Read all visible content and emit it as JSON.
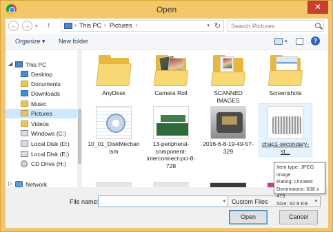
{
  "window": {
    "title": "Open",
    "close_glyph": "✕"
  },
  "address_bar": {
    "back_glyph": "←",
    "forward_glyph": "→",
    "up_glyph": "↑",
    "crumbs": [
      "This PC",
      "Pictures"
    ],
    "separator": "›",
    "refresh_glyph": "↻",
    "search_placeholder": "Search Pictures"
  },
  "toolbar": {
    "organize": "Organize ▾",
    "new_folder": "New folder",
    "help_glyph": "?"
  },
  "nav": {
    "items": [
      {
        "label": "This PC",
        "icon": "computer-icon"
      },
      {
        "label": "Desktop",
        "icon": "folder-icon"
      },
      {
        "label": "Documents",
        "icon": "folder-icon"
      },
      {
        "label": "Downloads",
        "icon": "download-folder-icon"
      },
      {
        "label": "Music",
        "icon": "music-folder-icon"
      },
      {
        "label": "Pictures",
        "icon": "pictures-folder-icon",
        "selected": true
      },
      {
        "label": "Videos",
        "icon": "videos-folder-icon"
      },
      {
        "label": "Windows (C:)",
        "icon": "drive-icon"
      },
      {
        "label": "Local Disk (D:)",
        "icon": "drive-icon"
      },
      {
        "label": "Local Disk (E:)",
        "icon": "drive-icon"
      },
      {
        "label": "CD Drive (H:)",
        "icon": "cd-drive-icon"
      },
      {
        "label": "Network",
        "icon": "network-icon"
      }
    ]
  },
  "files": [
    {
      "name": "AnyDesk",
      "kind": "folder"
    },
    {
      "name": "Camera Roll",
      "kind": "folder"
    },
    {
      "name": "SCANNED IMAGES",
      "kind": "folder"
    },
    {
      "name": "Screenshots",
      "kind": "folder"
    },
    {
      "name": "10_01_DiskMechanism",
      "kind": "image"
    },
    {
      "name": "13-peripheral-component-interconnect-pci-8-728",
      "kind": "image"
    },
    {
      "name": "2016-6-8-19-49-57-329",
      "kind": "image"
    },
    {
      "name": "chap1-secondary-st...",
      "kind": "image"
    }
  ],
  "tooltip": {
    "item_type": "Item type: JPEG image",
    "rating": "Rating: Unrated",
    "dimensions": "Dimensions: 638 x 479",
    "size": "Size: 92.9 KB"
  },
  "footer": {
    "file_name_label": "File name:",
    "file_name_value": "",
    "filter": "Custom Files",
    "open_label": "Open",
    "cancel_label": "Cancel"
  }
}
